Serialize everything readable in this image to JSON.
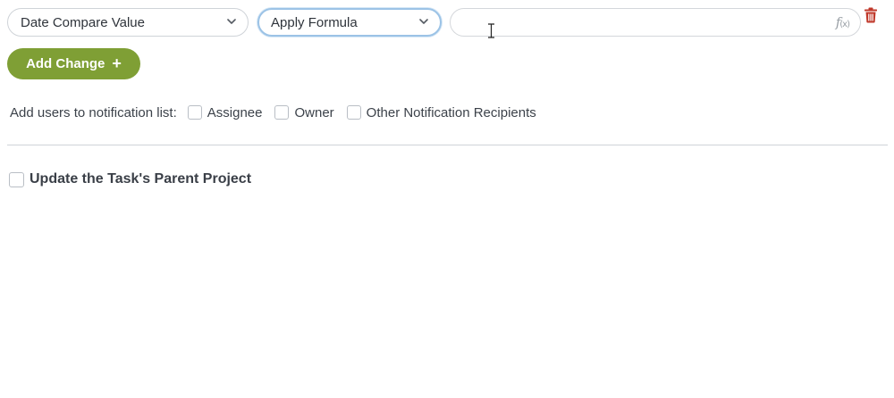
{
  "rule": {
    "field_select": {
      "value": "Date Compare Value",
      "icon": "chevron-down-icon"
    },
    "operation_select": {
      "value": "Apply Formula",
      "icon": "chevron-down-icon"
    },
    "formula_input": {
      "value": "",
      "placeholder": "",
      "fx_glyph": "f",
      "fx_sub": "(x)"
    },
    "delete_icon": "trash-icon"
  },
  "add_change": {
    "label": "Add Change",
    "plus": "+"
  },
  "notification": {
    "label": "Add users to notification list:",
    "options": [
      {
        "label": "Assignee",
        "checked": false
      },
      {
        "label": "Owner",
        "checked": false
      },
      {
        "label": "Other Notification Recipients",
        "checked": false
      }
    ]
  },
  "parent_project": {
    "label": "Update the Task's Parent Project",
    "checked": false
  },
  "colors": {
    "accent": "#7f9f35",
    "danger": "#c0392b",
    "focus": "#9cc3e6",
    "border": "#cfd3d8"
  }
}
